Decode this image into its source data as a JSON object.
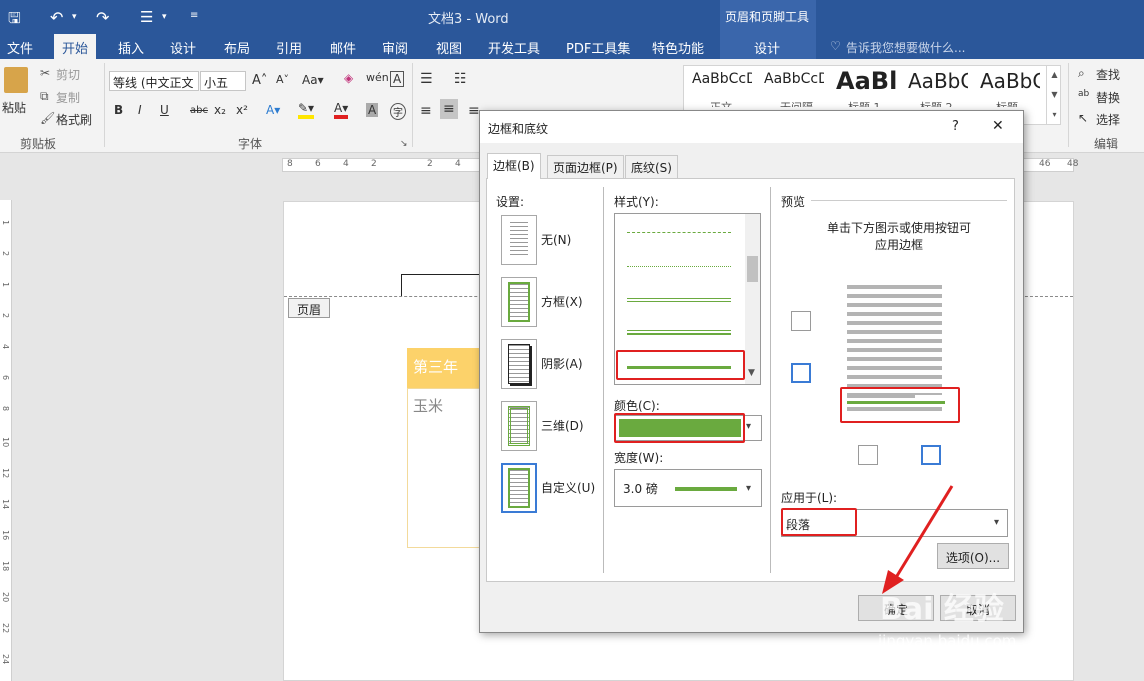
{
  "window": {
    "doc_title": "文档3 - Word",
    "context_group": "页眉和页脚工具"
  },
  "tabs": [
    "文件",
    "开始",
    "插入",
    "设计",
    "布局",
    "引用",
    "邮件",
    "审阅",
    "视图",
    "开发工具",
    "PDF工具集",
    "特色功能"
  ],
  "context_tab": "设计",
  "tell_me": "告诉我您想要做什么...",
  "ribbon": {
    "clipboard": {
      "paste": "粘贴",
      "cut": "剪切",
      "copy": "复制",
      "format_painter": "格式刷",
      "group": "剪贴板"
    },
    "font": {
      "name": "等线 (中文正文",
      "size": "小五",
      "group": "字体",
      "bold": "B",
      "italic": "I",
      "underline": "U",
      "strike": "abc",
      "sub": "x₂",
      "sup": "x²"
    },
    "styles": [
      "AaBbCcDı",
      "AaBbCcDı",
      "AaBl",
      "AaBbC",
      "AaBbC"
    ],
    "style_names": [
      "正文",
      "无间隔",
      "标题 1",
      "标题 2",
      "标题"
    ],
    "editing": {
      "find": "查找",
      "replace": "替换",
      "select": "选择",
      "group": "编辑"
    }
  },
  "ruler_numbers": [
    "8",
    "6",
    "4",
    "2",
    "2",
    "4",
    "46",
    "48"
  ],
  "vruler_numbers": [
    "1",
    "2",
    "1",
    "2",
    "4",
    "6",
    "8",
    "10",
    "12",
    "14",
    "16",
    "18",
    "20",
    "22",
    "24"
  ],
  "document": {
    "header_tag": "页眉",
    "cell_head": "第三年",
    "cell_body": "玉米"
  },
  "dialog": {
    "title": "边框和底纹",
    "help": "?",
    "close": "✕",
    "tabs": [
      "边框(B)",
      "页面边框(P)",
      "底纹(S)"
    ],
    "settings_label": "设置:",
    "settings": [
      "无(N)",
      "方框(X)",
      "阴影(A)",
      "三维(D)",
      "自定义(U)"
    ],
    "style_label": "样式(Y):",
    "color_label": "颜色(C):",
    "color_value": "#6aaa3f",
    "width_label": "宽度(W):",
    "width_value": "3.0 磅",
    "preview_label": "预览",
    "preview_hint_1": "单击下方图示或使用按钮可",
    "preview_hint_2": "应用边框",
    "apply_label": "应用于(L):",
    "apply_value": "段落",
    "options_button": "选项(O)...",
    "ok_button": "确定",
    "cancel_button": "取消"
  },
  "watermark": {
    "brand": "Bai 经验",
    "url": "jingyan.baidu.com"
  },
  "colors": {
    "word_blue": "#2b579a",
    "accent_green": "#6aaa3f",
    "highlight_red": "#e02020"
  }
}
